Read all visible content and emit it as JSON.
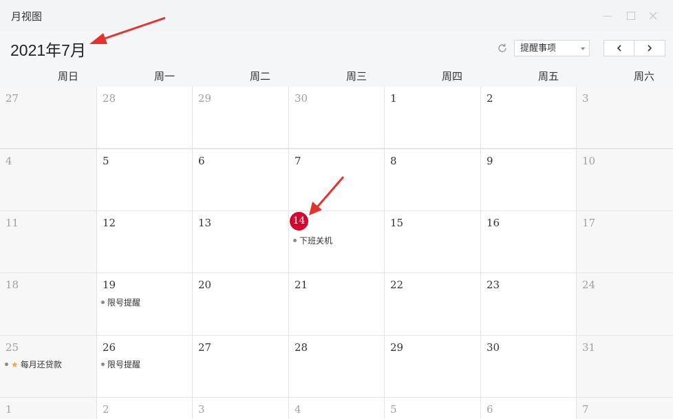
{
  "window": {
    "title": "月视图"
  },
  "header": {
    "month_title": "2021年7月",
    "filter_value": "提醒事项"
  },
  "weekdays": [
    "周日",
    "周一",
    "周二",
    "周三",
    "周四",
    "周五",
    "周六"
  ],
  "weeks": [
    [
      "27",
      "28",
      "29",
      "30",
      "1",
      "2",
      "3"
    ],
    [
      "4",
      "5",
      "6",
      "7",
      "8",
      "9",
      "10"
    ],
    [
      "11",
      "12",
      "13",
      "14",
      "15",
      "16",
      "17"
    ],
    [
      "18",
      "19",
      "20",
      "21",
      "22",
      "23",
      "24"
    ],
    [
      "25",
      "26",
      "27",
      "28",
      "29",
      "30",
      "31"
    ],
    [
      "1",
      "2",
      "3",
      "4",
      "5",
      "6",
      "7"
    ]
  ],
  "today": "14",
  "events": {
    "offwork": "下班关机",
    "plate_19": "限号提醒",
    "plate_26": "限号提醒",
    "loan": "每月还贷款"
  },
  "colors": {
    "today": "#d8002c",
    "annotation_arrow": "#e5322d",
    "star": "#f5a623"
  },
  "icons": {
    "refresh": "refresh-icon",
    "prev": "chevron-left-icon",
    "next": "chevron-right-icon",
    "star": "star-icon"
  }
}
